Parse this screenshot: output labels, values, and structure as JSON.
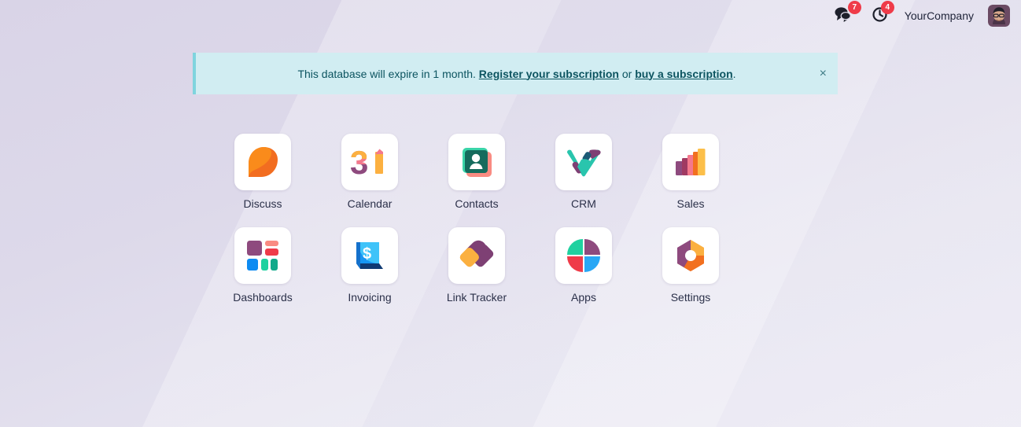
{
  "topbar": {
    "messages": {
      "icon": "speech-bubbles-icon",
      "count": "7"
    },
    "activities": {
      "icon": "clock-icon",
      "count": "4"
    },
    "company": "YourCompany",
    "avatar_icon": "user-avatar"
  },
  "alert": {
    "text_before": "This database will expire in 1 month.",
    "link1": "Register your subscription",
    "middle": "or",
    "link2": "buy a subscription",
    "text_after": ".",
    "close_label": "×",
    "bg_color": "#d1edf2",
    "border_color": "#7fd4de",
    "text_color": "#0c5460"
  },
  "apps": [
    {
      "label": "Discuss",
      "icon": "discuss-icon"
    },
    {
      "label": "Calendar",
      "icon": "calendar-icon"
    },
    {
      "label": "Contacts",
      "icon": "contacts-icon"
    },
    {
      "label": "CRM",
      "icon": "crm-icon"
    },
    {
      "label": "Sales",
      "icon": "sales-icon"
    },
    {
      "label": "Dashboards",
      "icon": "dashboards-icon"
    },
    {
      "label": "Invoicing",
      "icon": "invoicing-icon"
    },
    {
      "label": "Link Tracker",
      "icon": "link-tracker-icon"
    },
    {
      "label": "Apps",
      "icon": "apps-icon"
    },
    {
      "label": "Settings",
      "icon": "settings-icon"
    }
  ],
  "colors": {
    "background_top": "#d9d4e7",
    "background_bottom": "#eceaf4",
    "badge": "#ef3b49",
    "label_text": "#2b3049"
  }
}
